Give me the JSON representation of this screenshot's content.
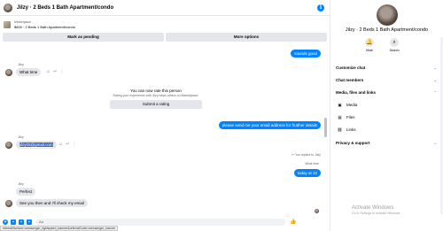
{
  "header": {
    "title": "Jilzy · 2 Beds 1 Bath Apartment/condo"
  },
  "listing": {
    "category": "Marketplace",
    "name": "$600 · 2 Beds 1 Bath Apartment/condo"
  },
  "actions": {
    "mark_pending": "Mark as pending",
    "more_options": "More options"
  },
  "messages": {
    "sounds_good": "sounds good",
    "sender_1": "Jilzy",
    "what_time": "What time",
    "rate_title": "You can now rate this person",
    "rate_sub": "Rating your experience with Jilzy helps others on Marketplace.",
    "rate_button": "Submit a rating",
    "email_request": "please send me your email address for frutther details",
    "sender_2": "Jilzy",
    "email": "jilzy03@gmail.com",
    "replied": "You replied to Jilzy",
    "quoted": "What time",
    "today": "today at 12",
    "sender_3": "Jilzy",
    "perfect": "Perfect",
    "see_you": "See you then and I'll check my email"
  },
  "composer": {
    "placeholder": "Aa",
    "status_url": "referralSurface=messenger_lightspeed_banner&referralCode=messenger_banner"
  },
  "panel": {
    "title": "Jilzy · 2 Beds 1 Bath Apartment/condo",
    "mute": "Mute",
    "search": "Search",
    "customize": "Customize chat",
    "members": "Chat members",
    "media_files": "Media, files and links",
    "media": "Media",
    "files": "Files",
    "links": "Links",
    "privacy": "Privacy & support"
  },
  "watermark": {
    "title": "Activate Windows",
    "sub": "Go to Settings to activate Windows."
  },
  "colors": {
    "accent": "#0084ff",
    "bubble_in": "#e4e6eb"
  }
}
